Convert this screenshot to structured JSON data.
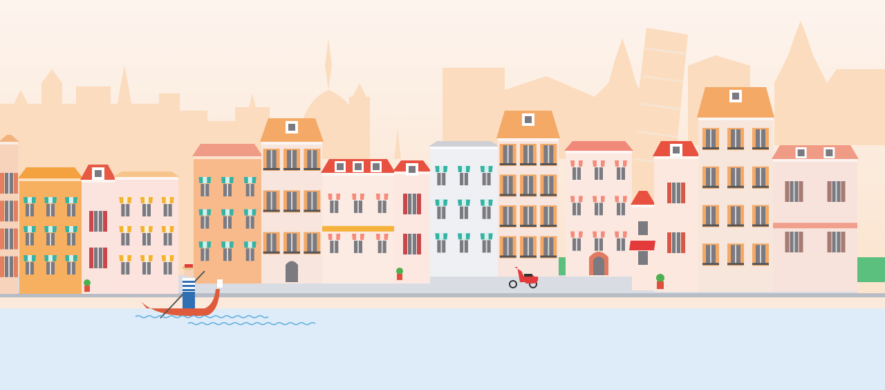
{
  "scene": {
    "subject": "illustrated-venetian-waterfront",
    "colors": {
      "sky_top": "#fdf4ee",
      "sky_bottom": "#fbe3cd",
      "skyline_far": "#fbdcbf",
      "skyline_near": "#f8cfa6",
      "promenade": "#d9dce3",
      "sand": "#fbeadc",
      "water": "#deebf8",
      "wave": "#5aaee0",
      "gondola": "#e05a3c",
      "grass": "#5bbf7e"
    },
    "icons": [
      "gondola-icon",
      "gondolier-icon",
      "scooter-icon",
      "potted-plant-icon",
      "leaning-tower-icon",
      "dome-icon"
    ]
  }
}
